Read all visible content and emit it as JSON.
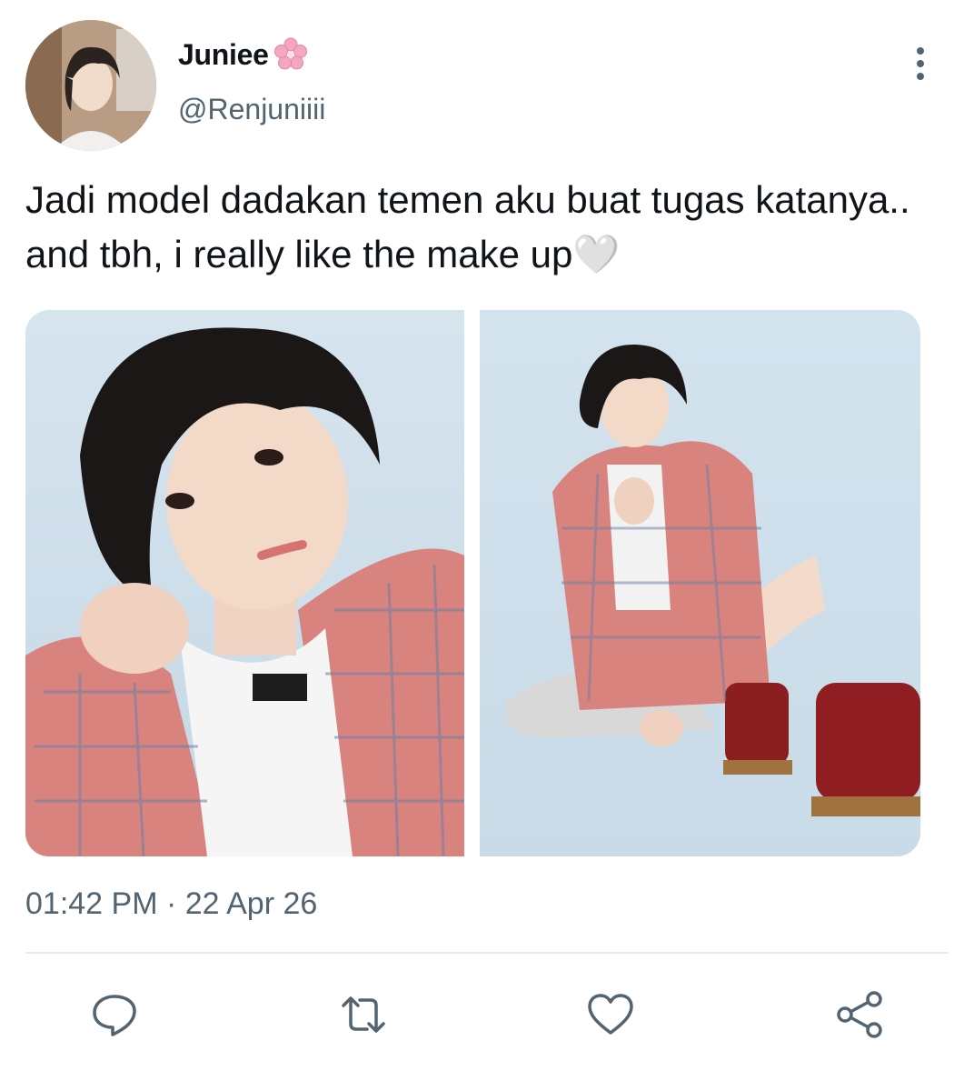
{
  "author": {
    "display_name": "Juniee",
    "name_emoji": "cherry-blossom-icon",
    "handle": "@Renjuniiii"
  },
  "tweet": {
    "text": "Jadi model dadakan temen aku buat tugas katanya.. and tbh, i really like the make up🤍",
    "timestamp": "01:42 PM · 22 Apr 26"
  },
  "media": [
    {
      "name": "photo-closeup"
    },
    {
      "name": "photo-full-body"
    }
  ],
  "actions": [
    {
      "icon": "reply-icon"
    },
    {
      "icon": "retweet-icon"
    },
    {
      "icon": "like-icon"
    },
    {
      "icon": "share-icon"
    }
  ],
  "colors": {
    "text": "#0f1419",
    "secondary": "#536471",
    "divider": "#e6e9ec",
    "photo_bg": "#cfe0ec",
    "jacket": "#d9837f"
  }
}
